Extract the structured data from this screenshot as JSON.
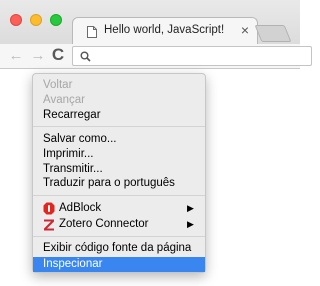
{
  "tab": {
    "title": "Hello world, JavaScript!",
    "close_glyph": "×"
  },
  "toolbar": {
    "back_glyph": "←",
    "forward_glyph": "→",
    "reload_glyph": "C",
    "omnibox_value": ""
  },
  "context_menu": {
    "back": "Voltar",
    "forward": "Avançar",
    "reload": "Recarregar",
    "save_as": "Salvar como...",
    "print": "Imprimir...",
    "cast": "Transmitir...",
    "translate": "Traduzir para o português",
    "adblock": "AdBlock",
    "zotero": "Zotero Connector",
    "view_source": "Exibir código fonte da página",
    "inspect": "Inspecionar",
    "submenu_glyph": "▶"
  },
  "colors": {
    "highlight": "#3a86f0",
    "adblock_red": "#e2261f",
    "zotero_red": "#cc2936",
    "traffic_close": "#fc5f57",
    "traffic_min": "#fdbc2e",
    "traffic_max": "#28c840"
  },
  "icons": {
    "tab": "page-icon",
    "omnibox": "search-icon",
    "adblock": "adblock-icon",
    "zotero": "zotero-icon"
  }
}
